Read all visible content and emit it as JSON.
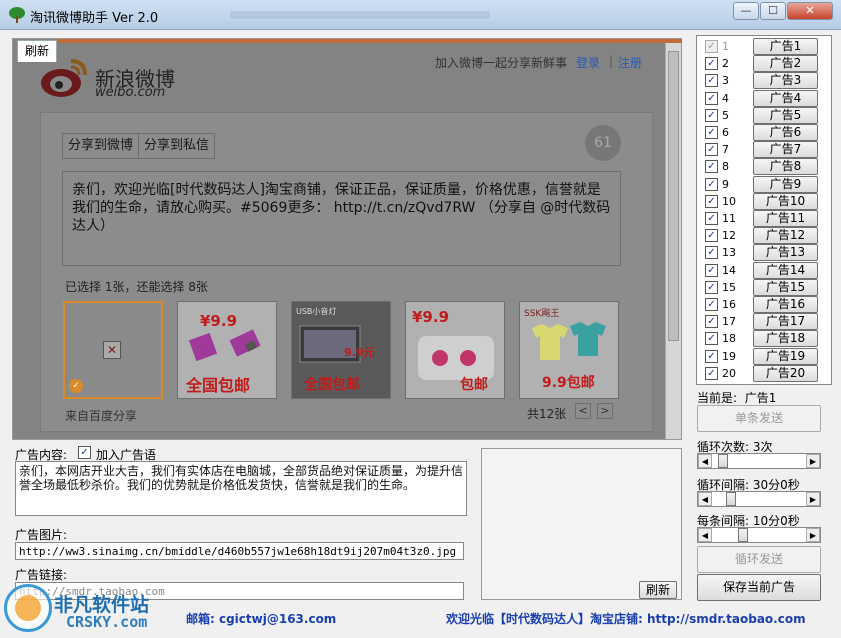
{
  "window": {
    "title": "淘讯微博助手 Ver 2.0",
    "controls": {
      "minimize": "—",
      "maximize": "☐",
      "close": "✕"
    }
  },
  "browser_tab": {
    "label": "刷新"
  },
  "weibo": {
    "brand_name": "新浪微博",
    "brand_domain": "weibo.com",
    "header_text": "加入微博一起分享新鲜事",
    "login": "登录",
    "register": "注册",
    "share_tabs": [
      "分享到微博",
      "分享到私信"
    ],
    "remaining_count": "61",
    "message": "亲们，欢迎光临[时代数码达人]淘宝商铺，保证正品，保证质量，价格优惠，信誉就是我们的生命，请放心购买。#5069更多： http://t.cn/zQvd7RW （分享自 @时代数码达人）",
    "selected_info": "已选择 1张，还能选择 8张",
    "from_baidu": "来自百度分享",
    "total": "共12张",
    "prev": "<",
    "next": ">",
    "thumbs": [
      {
        "price": "",
        "promo": ""
      },
      {
        "price": "¥9.9",
        "promo": "全国包邮"
      },
      {
        "price": "9.9元",
        "promo": "全国包邮",
        "caption": "USB小音灯"
      },
      {
        "price": "¥9.9",
        "promo": "包邮"
      },
      {
        "price": "",
        "promo": "9.9包邮",
        "caption": "SSK飚王"
      }
    ]
  },
  "ad_content": {
    "label": "广告内容:",
    "add_ad_label": "加入广告语",
    "add_ad_checked": true,
    "text": "亲们，本网店开业大吉，我们有实体店在电脑城，全部货品绝对保证质量，为提升信誉全场最低秒杀价。我们的优势就是价格低发货快，信誉就是我们的生命。"
  },
  "ad_image": {
    "label": "广告图片:",
    "value": "http://ww3.sinaimg.cn/bmiddle/d460b557jw1e68h18dt9ij207m04t3z0.jpg"
  },
  "ad_link": {
    "label": "广告链接:",
    "value": "http://smdr.taobao.com"
  },
  "refresh_button": "刷新",
  "ad_list": [
    {
      "num": "1",
      "label": "广告1",
      "checked": true,
      "disabled": true
    },
    {
      "num": "2",
      "label": "广告2",
      "checked": true
    },
    {
      "num": "3",
      "label": "广告3",
      "checked": true
    },
    {
      "num": "4",
      "label": "广告4",
      "checked": true
    },
    {
      "num": "5",
      "label": "广告5",
      "checked": true
    },
    {
      "num": "6",
      "label": "广告6",
      "checked": true
    },
    {
      "num": "7",
      "label": "广告7",
      "checked": true
    },
    {
      "num": "8",
      "label": "广告8",
      "checked": true
    },
    {
      "num": "9",
      "label": "广告9",
      "checked": true
    },
    {
      "num": "10",
      "label": "广告10",
      "checked": true
    },
    {
      "num": "11",
      "label": "广告11",
      "checked": true
    },
    {
      "num": "12",
      "label": "广告12",
      "checked": true
    },
    {
      "num": "13",
      "label": "广告13",
      "checked": true
    },
    {
      "num": "14",
      "label": "广告14",
      "checked": true
    },
    {
      "num": "15",
      "label": "广告15",
      "checked": true
    },
    {
      "num": "16",
      "label": "广告16",
      "checked": true
    },
    {
      "num": "17",
      "label": "广告17",
      "checked": true
    },
    {
      "num": "18",
      "label": "广告18",
      "checked": true
    },
    {
      "num": "19",
      "label": "广告19",
      "checked": true
    },
    {
      "num": "20",
      "label": "广告20",
      "checked": true
    }
  ],
  "controls": {
    "current_label": "当前是:",
    "current_value": "广告1",
    "single_send": "单条发送",
    "loop_count_label": "循环次数: 3次",
    "loop_count_value": 3,
    "loop_interval_label": "循环间隔: 30分0秒",
    "loop_interval_value": 30,
    "each_interval_label": "每条间隔: 10分0秒",
    "each_interval_value": 10,
    "loop_send": "循环发送",
    "save_current": "保存当前广告"
  },
  "footer": {
    "email": "邮箱: cgictwj@163.com",
    "welcome": "欢迎光临【时代数码达人】淘宝店铺: http://smdr.taobao.com"
  },
  "watermark": {
    "cn": "非凡软件站",
    "en": "CRSKY.com"
  },
  "colors": {
    "accent": "#1a3fb0",
    "promo": "#c31b1b",
    "weibo_blue": "#2a5ab0"
  }
}
